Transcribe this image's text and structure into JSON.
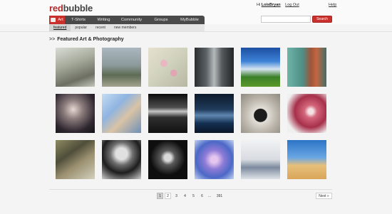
{
  "logo": {
    "part1": "red",
    "part2": "bubble"
  },
  "user_nav": {
    "greeting": "Hi",
    "username": "LoisBryan",
    "logout": "Log Out",
    "help": "Help"
  },
  "search": {
    "placeholder": "",
    "button_label": "Search"
  },
  "main_nav": {
    "items": [
      {
        "label": "Art",
        "active": true
      },
      {
        "label": "T-Shirts",
        "active": false
      },
      {
        "label": "Writing",
        "active": false
      },
      {
        "label": "Community",
        "active": false
      },
      {
        "label": "Groups",
        "active": false
      },
      {
        "label": "MyBubble",
        "active": false
      }
    ]
  },
  "sub_nav": {
    "items": [
      {
        "label": "featured",
        "active": true
      },
      {
        "label": "popular",
        "active": false
      },
      {
        "label": "recent",
        "active": false
      },
      {
        "label": "new members",
        "active": false
      }
    ]
  },
  "section": {
    "arrows": ">>",
    "title": "Featured Art & Photography"
  },
  "gallery": [
    "surreal figure collage",
    "girl with windmill house",
    "pink blossoms",
    "city street in rain",
    "blue sky over field",
    "rusty turquoise door",
    "boy in dark hallway",
    "portrait of man in blue cap",
    "stormy sky over sea",
    "misty blue lake",
    "hands holding dark soil",
    "pink dahlia",
    "feathered wings",
    "aviator goggles portrait",
    "glowing glass reflection",
    "blue and pink flower",
    "winter jetty",
    "desert beach with tree"
  ],
  "pagination": {
    "pages": [
      "1",
      "2",
      "3",
      "4",
      "5",
      "6",
      "...",
      "391"
    ],
    "current": "1",
    "next": "Next »"
  },
  "colors": {
    "brand_red": "#c9302c",
    "nav_dark": "#4a4a4a"
  }
}
